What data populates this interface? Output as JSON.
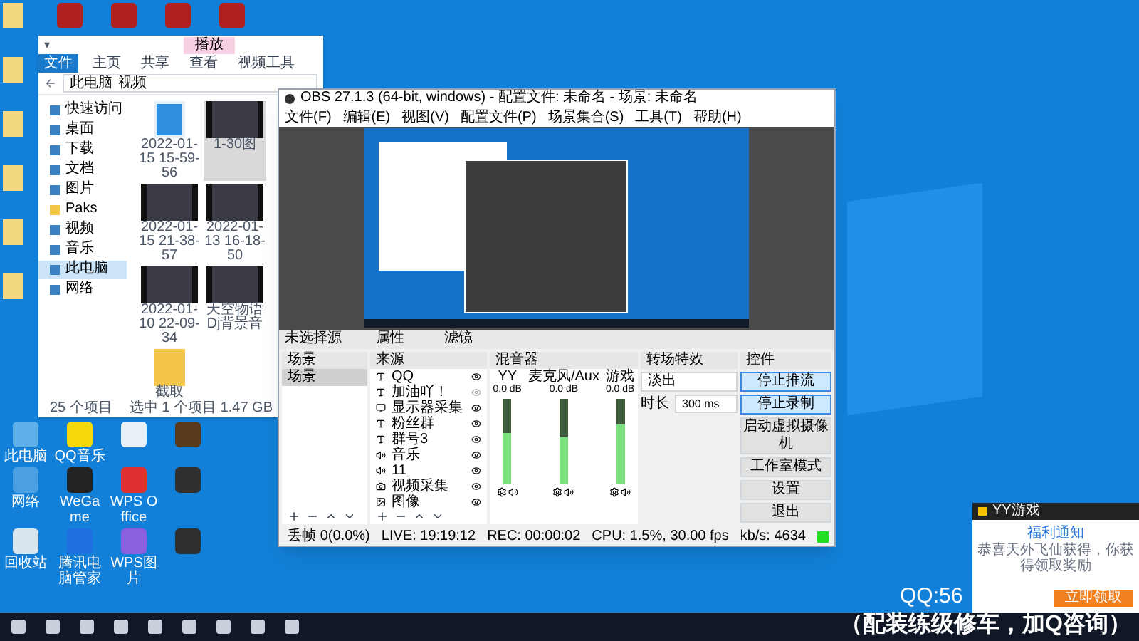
{
  "desktop_icons": [
    {
      "label": "此电脑",
      "kind": "pc"
    },
    {
      "label": "QQ音乐",
      "kind": "music"
    },
    {
      "kind": "screen"
    },
    {
      "kind": "game"
    },
    {
      "label": "网络",
      "kind": "network"
    },
    {
      "label": "WeGame",
      "kind": "wegame"
    },
    {
      "label": "WPS Office",
      "kind": "wps"
    },
    {
      "kind": "dark"
    },
    {
      "label": "回收站",
      "kind": "recycle"
    },
    {
      "label": "腾讯电脑管家",
      "kind": "shield"
    },
    {
      "label": "WPS图片",
      "kind": "photo"
    },
    {
      "kind": "dark"
    }
  ],
  "explorer": {
    "quick_tools": "▾",
    "context_tab": "播放",
    "ribbon_tabs": [
      {
        "label": "文件",
        "selected": true
      },
      {
        "label": "主页",
        "selected": false
      },
      {
        "label": "共享",
        "selected": false
      },
      {
        "label": "查看",
        "selected": false
      },
      {
        "label": "视频工具",
        "selected": false
      }
    ],
    "path": [
      "此电脑",
      "视频"
    ],
    "nav": [
      {
        "label": "快速访问",
        "kind": "star",
        "selected": false
      },
      {
        "label": "桌面",
        "kind": "desk",
        "selected": false
      },
      {
        "label": "下载",
        "kind": "down",
        "selected": false
      },
      {
        "label": "文档",
        "kind": "doc",
        "selected": false
      },
      {
        "label": "图片",
        "kind": "pic",
        "selected": false
      },
      {
        "label": "Paks",
        "kind": "folder",
        "selected": false
      },
      {
        "label": "视频",
        "kind": "video",
        "selected": false
      },
      {
        "label": "音乐",
        "kind": "music",
        "selected": false
      },
      {
        "label": "此电脑",
        "kind": "pc",
        "selected": true
      },
      {
        "label": "网络",
        "kind": "net",
        "selected": false
      }
    ],
    "files": [
      {
        "name": "2022-01-15 15-59-56",
        "kind": "player",
        "selected": false
      },
      {
        "name": "1-30图",
        "kind": "video",
        "selected": true
      },
      {
        "name": "2022-01-15 21-38-57",
        "kind": "video",
        "selected": false
      },
      {
        "name": "2022-01-13 16-18-50",
        "kind": "video",
        "selected": false
      },
      {
        "name": "2022-01-10 22-09-34",
        "kind": "video",
        "selected": false
      },
      {
        "name": "天空物语Dj背景音",
        "kind": "video",
        "selected": false
      },
      {
        "name": "截取",
        "kind": "folder",
        "selected": false
      }
    ],
    "status": [
      "25 个项目",
      "选中 1 个项目  1.47 GB"
    ]
  },
  "obs": {
    "title": "OBS 27.1.3 (64-bit, windows) - 配置文件: 未命名 - 场景: 未命名",
    "menu": [
      "文件(F)",
      "编辑(E)",
      "视图(V)",
      "配置文件(P)",
      "场景集合(S)",
      "工具(T)",
      "帮助(H)"
    ],
    "source_bar": {
      "label": "未选择源",
      "buttons": [
        "属性",
        "滤镜"
      ]
    },
    "scenes": {
      "title": "场景",
      "items": [
        {
          "label": "场景",
          "selected": true
        }
      ]
    },
    "sources": {
      "title": "来源",
      "items": [
        {
          "label": "QQ",
          "kind": "text",
          "visible": true
        },
        {
          "label": "加油吖！",
          "kind": "text",
          "visible": false
        },
        {
          "label": "显示器采集",
          "kind": "display",
          "visible": true
        },
        {
          "label": "粉丝群",
          "kind": "text",
          "visible": true
        },
        {
          "label": "群号3",
          "kind": "text",
          "visible": true
        },
        {
          "label": "音乐",
          "kind": "audio",
          "visible": true
        },
        {
          "label": "11",
          "kind": "audio",
          "visible": true
        },
        {
          "label": "视频采集",
          "kind": "camera",
          "visible": true
        },
        {
          "label": "图像",
          "kind": "image",
          "visible": true
        }
      ]
    },
    "mixer": {
      "title": "混音器",
      "channels": [
        {
          "name": "YY",
          "reading": "0.0 dB",
          "level": 0.6
        },
        {
          "name": "麦克风/Aux",
          "reading": "0.0 dB",
          "level": 0.55
        },
        {
          "name": "游戏",
          "reading": "0.0 dB",
          "level": 0.7
        }
      ]
    },
    "transitions": {
      "title": "转场特效",
      "type": "淡出",
      "duration_label": "时长",
      "duration": "300 ms"
    },
    "controls": {
      "title": "控件",
      "buttons": [
        {
          "label": "停止推流",
          "on": true
        },
        {
          "label": "停止录制",
          "on": true
        },
        {
          "label": "启动虚拟摄像机",
          "on": false
        },
        {
          "label": "工作室模式",
          "on": false
        },
        {
          "label": "设置",
          "on": false
        },
        {
          "label": "退出",
          "on": false
        }
      ]
    },
    "status": [
      "丢帧 0(0.0%)",
      "LIVE: 19:19:12",
      "REC: 00:00:02",
      "CPU: 1.5%, 30.00 fps",
      "kb/s: 4634"
    ]
  },
  "overlay": {
    "qq": "QQ:56",
    "caption": "（配装练级修车，加Q咨询）"
  },
  "popup": {
    "app": "YY游戏",
    "heading": "福利通知",
    "message": "恭喜天外飞仙获得，你获得领取奖励",
    "button": "立即领取"
  }
}
